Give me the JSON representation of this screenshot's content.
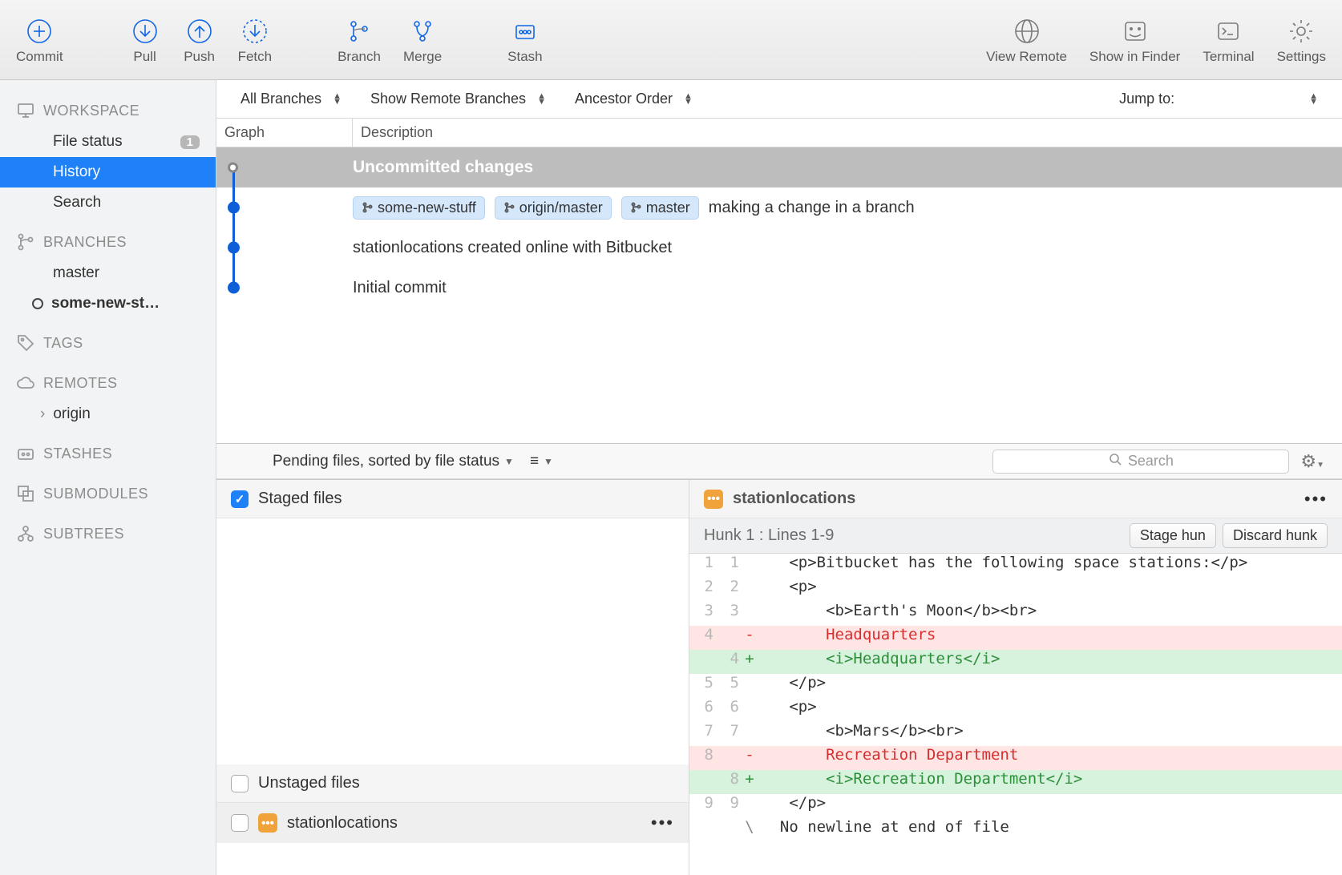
{
  "toolbar": {
    "commit": "Commit",
    "pull": "Pull",
    "push": "Push",
    "fetch": "Fetch",
    "branch": "Branch",
    "merge": "Merge",
    "stash": "Stash",
    "view_remote": "View Remote",
    "show_in_finder": "Show in Finder",
    "terminal": "Terminal",
    "settings": "Settings"
  },
  "sidebar": {
    "workspace": {
      "title": "WORKSPACE",
      "items": [
        {
          "label": "File status",
          "badge": "1"
        },
        {
          "label": "History"
        },
        {
          "label": "Search"
        }
      ]
    },
    "branches": {
      "title": "BRANCHES",
      "items": [
        {
          "label": "master"
        },
        {
          "label": "some-new-st…"
        }
      ]
    },
    "tags": {
      "title": "TAGS"
    },
    "remotes": {
      "title": "REMOTES",
      "items": [
        {
          "label": "origin"
        }
      ]
    },
    "stashes": {
      "title": "STASHES"
    },
    "submodules": {
      "title": "SUBMODULES"
    },
    "subtrees": {
      "title": "SUBTREES"
    }
  },
  "filters": {
    "all_branches": "All Branches",
    "show_remote": "Show Remote Branches",
    "ancestor": "Ancestor Order",
    "jump_to": "Jump to:"
  },
  "columns": {
    "graph": "Graph",
    "description": "Description"
  },
  "commits": {
    "uncommitted": "Uncommitted changes",
    "rows": [
      {
        "tags": [
          "some-new-stuff",
          "origin/master",
          "master"
        ],
        "message": "making a change in a branch"
      },
      {
        "message": "stationlocations created online with Bitbucket"
      },
      {
        "message": "Initial commit"
      }
    ]
  },
  "pending": {
    "sorter": "Pending files, sorted by file status",
    "search_placeholder": "Search",
    "staged_label": "Staged files",
    "unstaged_label": "Unstaged files",
    "unstaged_file": "stationlocations"
  },
  "diff_panel": {
    "filename": "stationlocations",
    "hunk_label": "Hunk 1 : Lines 1-9",
    "stage_btn": "Stage hun",
    "discard_btn": "Discard hunk",
    "lines": [
      {
        "a": "1",
        "b": "1",
        "type": "ctx",
        "text": "   <p>Bitbucket has the following space stations:</p>"
      },
      {
        "a": "2",
        "b": "2",
        "type": "ctx",
        "text": "   <p>"
      },
      {
        "a": "3",
        "b": "3",
        "type": "ctx",
        "text": "       <b>Earth's Moon</b><br>"
      },
      {
        "a": "4",
        "b": "",
        "type": "del",
        "text": "       Headquarters"
      },
      {
        "a": "",
        "b": "4",
        "type": "add",
        "text": "       <i>Headquarters</i>"
      },
      {
        "a": "5",
        "b": "5",
        "type": "ctx",
        "text": "   </p>"
      },
      {
        "a": "6",
        "b": "6",
        "type": "ctx",
        "text": "   <p>"
      },
      {
        "a": "7",
        "b": "7",
        "type": "ctx",
        "text": "       <b>Mars</b><br>"
      },
      {
        "a": "8",
        "b": "",
        "type": "del",
        "text": "       Recreation Department"
      },
      {
        "a": "",
        "b": "8",
        "type": "add",
        "text": "       <i>Recreation Department</i>"
      },
      {
        "a": "9",
        "b": "9",
        "type": "ctx",
        "text": "   </p>"
      },
      {
        "a": "",
        "b": "",
        "type": "noeol",
        "text": "  No newline at end of file"
      }
    ]
  }
}
